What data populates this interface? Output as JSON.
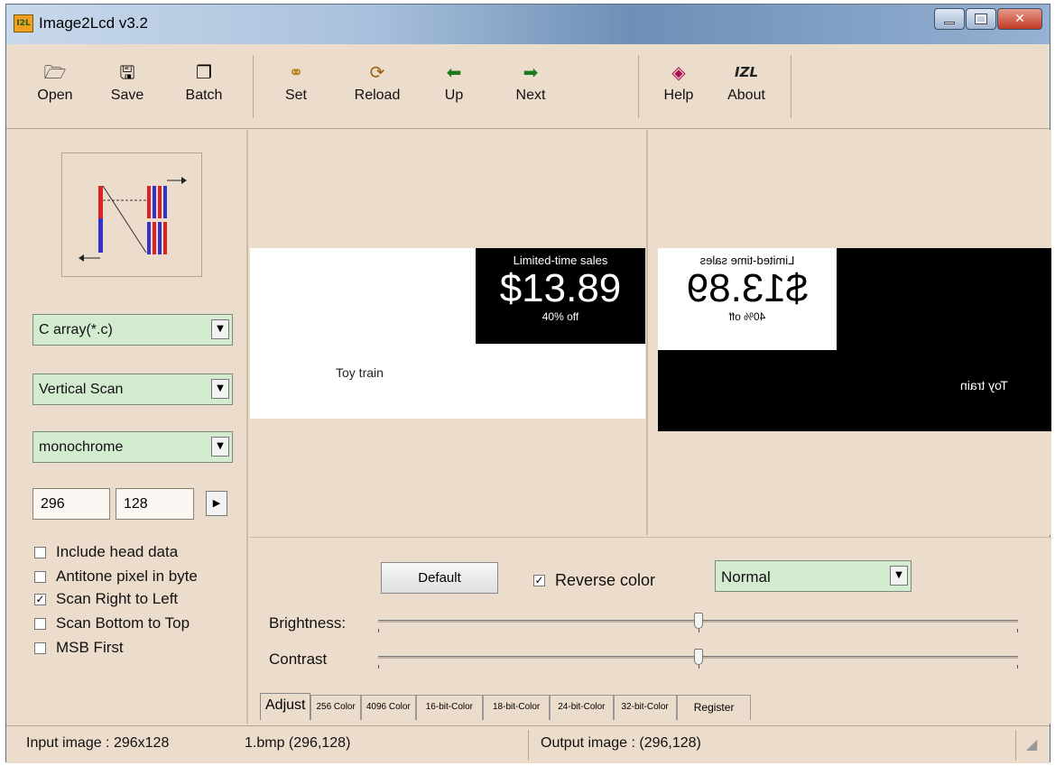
{
  "window": {
    "title": "Image2Lcd v3.2",
    "app_icon": "I2L"
  },
  "toolbar": {
    "items": [
      {
        "label": "Open",
        "icon": "open-icon"
      },
      {
        "label": "Save",
        "icon": "save-icon"
      },
      {
        "label": "Batch",
        "icon": "batch-icon"
      },
      {
        "label": "Set",
        "icon": "glasses-icon"
      },
      {
        "label": "Reload",
        "icon": "reload-icon"
      },
      {
        "label": "Up",
        "icon": "left-arrow-icon"
      },
      {
        "label": "Next",
        "icon": "right-arrow-icon"
      },
      {
        "label": "Help",
        "icon": "help-icon"
      },
      {
        "label": "About",
        "icon": "about-icon",
        "glyph": "IZL"
      }
    ]
  },
  "left": {
    "output_type": "C array(*.c)",
    "scan_mode": "Vertical Scan",
    "color_depth": "monochrome",
    "width": "296",
    "height": "128",
    "checkboxes": [
      {
        "label": "Include head data",
        "checked": false
      },
      {
        "label": "Antitone pixel in byte",
        "checked": false
      },
      {
        "label": "Scan Right to Left",
        "checked": true
      },
      {
        "label": "Scan Bottom to Top",
        "checked": false
      },
      {
        "label": "MSB First",
        "checked": false
      }
    ]
  },
  "preview": {
    "sale_text": "Limited-time sales",
    "price": "$13.89",
    "discount": "40% off",
    "product": "Toy train"
  },
  "adjust": {
    "default_label": "Default",
    "reverse_label": "Reverse color",
    "reverse_checked": true,
    "mode": "Normal",
    "brightness_label": "Brightness:",
    "contrast_label": "Contrast",
    "brightness_level": 0.5,
    "contrast_level": 0.5
  },
  "tabs": [
    "Adjust",
    "256 Color",
    "4096 Color",
    "16-bit-Color",
    "18-bit-Color",
    "24-bit-Color",
    "32-bit-Color",
    "Register"
  ],
  "status": {
    "input": "Input image : 296x128",
    "file": "1.bmp  (296,128)",
    "output": "Output image : (296,128)"
  },
  "colors": {
    "background": "#ecdccb",
    "combo_bg": "#d3ecd0",
    "title_accent": "#6e8fb6"
  }
}
